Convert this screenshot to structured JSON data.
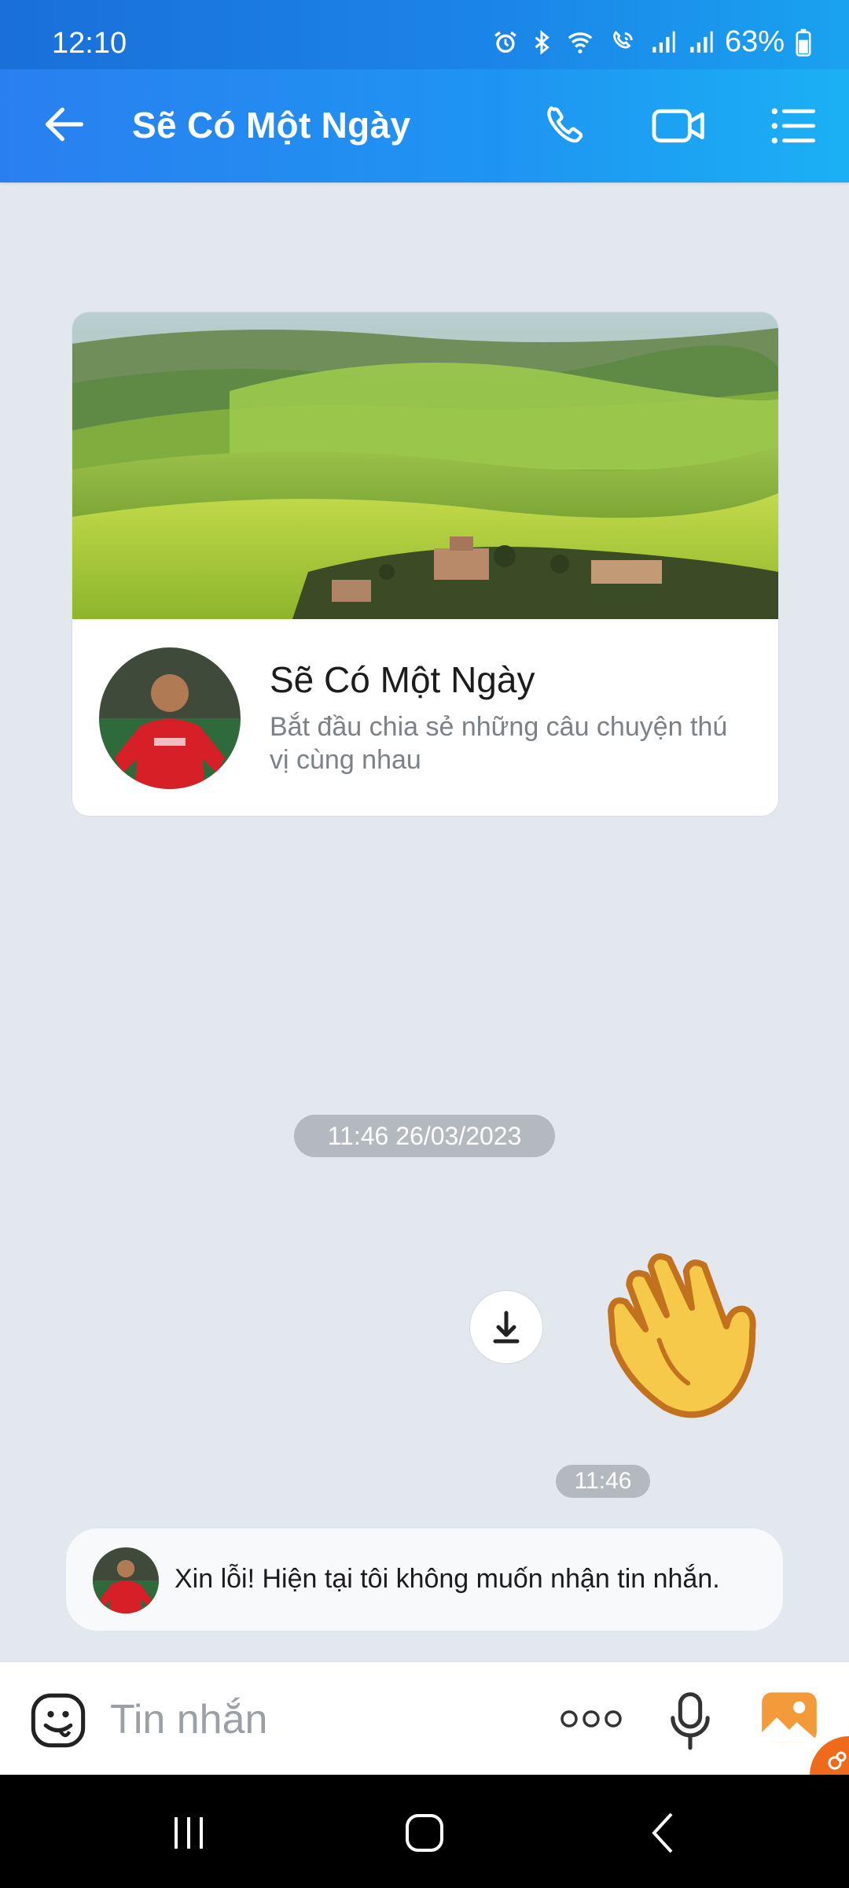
{
  "status_bar": {
    "time": "12:10",
    "battery": "63%"
  },
  "header": {
    "title": "Sẽ Có Một Ngày"
  },
  "cover_card": {
    "name": "Sẽ Có Một Ngày",
    "description": "Bắt đầu chia sẻ những câu chuyện thú vị cùng nhau"
  },
  "messages": {
    "date_separator": "11:46 26/03/2023",
    "sticker_time": "11:46",
    "auto_reply": "Xin lỗi! Hiện tại tôi không muốn nhận tin nhắn."
  },
  "composer": {
    "placeholder": "Tin nhắn"
  },
  "colors": {
    "header_gradient_start": "#2a7ff0",
    "header_gradient_end": "#1bb0f4",
    "chat_background": "#e3e7ee"
  },
  "icons": [
    "back-arrow-icon",
    "phone-icon",
    "video-call-icon",
    "menu-list-icon",
    "download-icon",
    "emoji-icon",
    "more-dots-icon",
    "microphone-icon",
    "gallery-icon"
  ]
}
